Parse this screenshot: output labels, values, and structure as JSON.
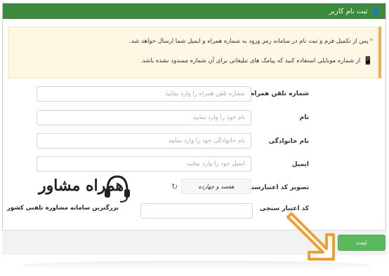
{
  "header": {
    "title": "ثبت نام کاربر",
    "icon": "user-plus-icon"
  },
  "alert": {
    "line1": "پس از تکمیل فرم و ثبت نام در سامانه رمز ورود به شماره همراه و ایمیل شما ارسال خواهد شد.",
    "star": "*",
    "line2": "از شماره موبایلی استفاده کنید که پیامک های تبلیغاتی برای آن شماره مسدود نشده باشد.",
    "icon": "mobile-phone-icon"
  },
  "form": {
    "fields": [
      {
        "label": "شماره تلفن همراه:",
        "placeholder": "شماره تلفن همراه را وارد نمایید",
        "value": ""
      },
      {
        "label": "نام",
        "placeholder": "نام خود را وارد نمایید",
        "value": ""
      },
      {
        "label": "نام خانوادگی",
        "placeholder": "نام خانوادگی خود را وارد نمایید",
        "value": ""
      },
      {
        "label": "ایمیل",
        "placeholder": "ایمیل خود را وارد نمایید",
        "value": ""
      }
    ],
    "captcha_label": "تصویر کد اعتبارسنجی",
    "captcha_text": "هفصد و چهارده",
    "captcha_input_label": "کد اعتبار سنجی",
    "captcha_input_value": "",
    "refresh_icon": "refresh-icon"
  },
  "footer": {
    "submit_label": "ثبت"
  },
  "watermark": {
    "title": "همراه مشاور",
    "subtitle": "بزرگترین سامانه مشاوره تلفنی کشور"
  },
  "colors": {
    "header_bg": "#3c8a3c",
    "alert_bg": "#fcf8e3",
    "alert_border": "#f0ad4e",
    "submit_bg": "#5cb85c",
    "arrow": "#f0a030"
  }
}
